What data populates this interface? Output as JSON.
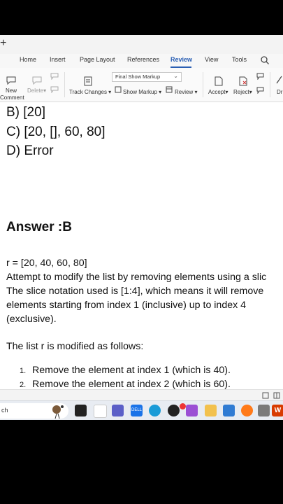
{
  "tab_strip": {
    "new_tab_label": "+"
  },
  "menu": {
    "home": "Home",
    "insert": "Insert",
    "page_layout": "Page Layout",
    "references": "References",
    "review": "Review",
    "view": "View",
    "tools": "Tools"
  },
  "toolbar": {
    "new_comment": "New",
    "new_comment_2": "Comment",
    "delete": "Delete",
    "markup_mode": "Final Show Markup",
    "track_changes": "Track Changes",
    "show_markup": "Show Markup",
    "review_btn": "Review",
    "accept": "Accept",
    "reject": "Reject",
    "more_cut": "Dr"
  },
  "document": {
    "option_b": "B) [20]",
    "option_c": "C) [20, [], 60, 80]",
    "option_d": "D) Error",
    "answer": "Answer :B",
    "code_line": "r = [20, 40, 60, 80]",
    "para1_line1": "Attempt to modify the list by removing elements using a slic",
    "para1_line2": "The slice notation used is [1:4], which means it will remove",
    "para1_line3": "elements starting from index 1 (inclusive) up to index 4",
    "para1_line4": "(exclusive).",
    "para2": "The list r is modified as follows:",
    "list": [
      {
        "num": "1.",
        "text": "Remove the element at index 1 (which is 40)."
      },
      {
        "num": "2.",
        "text": "Remove the element at index 2 (which is 60)."
      }
    ]
  },
  "taskbar": {
    "search_text": "ch"
  },
  "colors": {
    "accent": "#2b5fb3",
    "office_red": "#d83b01"
  }
}
